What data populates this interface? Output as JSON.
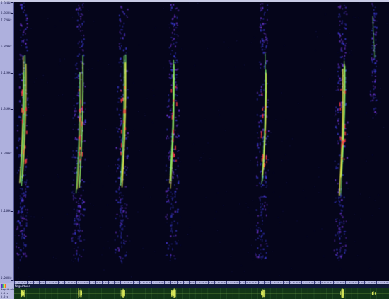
{
  "freq_axis": {
    "labels": [
      "8.01kHz",
      "8.86kHz",
      "7.72kHz",
      "6.82kHz",
      "5.12kHz",
      "4.31kHz",
      "3.38kHz",
      "2.14kHz",
      "0.00kHz"
    ],
    "positions": [
      0.0,
      0.04,
      0.065,
      0.16,
      0.255,
      0.385,
      0.545,
      0.75,
      1.0
    ]
  },
  "legend": {
    "row_labels": [
      "Magnitude",
      "",
      "0.0 s",
      "0.0 s"
    ]
  },
  "waveform": {
    "header_label": "Magnitude"
  },
  "time_axis": {
    "tick_label": "0.0s",
    "tick_count": 60
  },
  "calls": [
    {
      "x": 0.025,
      "intensity": 0.85
    },
    {
      "x": 0.175,
      "intensity": 1.0
    },
    {
      "x": 0.29,
      "intensity": 0.95
    },
    {
      "x": 0.425,
      "intensity": 1.0
    },
    {
      "x": 0.665,
      "intensity": 0.95
    },
    {
      "x": 0.875,
      "intensity": 0.95
    },
    {
      "x": 0.96,
      "intensity": 0.4
    }
  ],
  "colors": {
    "background": "#05051a",
    "low": "#3b3bd8",
    "mid": "#7a3ae8",
    "green": "#7cf06a",
    "yellow": "#e8ea4a",
    "red": "#ff3a44",
    "panel": "#aeb0dd",
    "waveform": "#d8e85a"
  }
}
